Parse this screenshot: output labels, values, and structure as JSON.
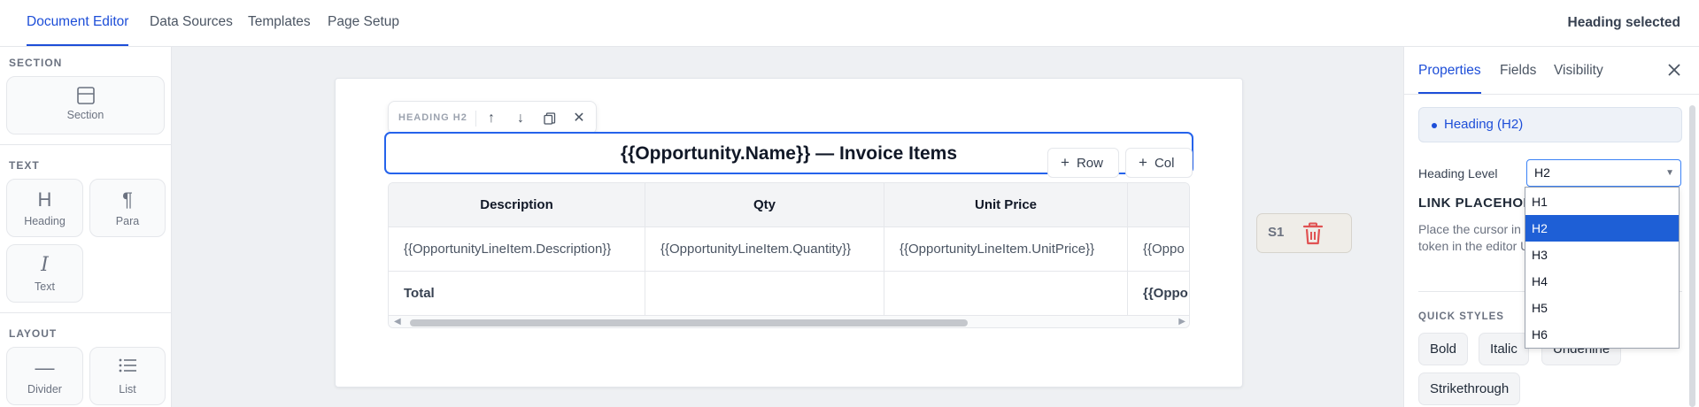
{
  "topnav": {
    "tabs": [
      "Document Editor",
      "Data Sources",
      "Templates",
      "Page Setup"
    ],
    "status": "Heading selected"
  },
  "palette": {
    "section_title": "SECTION",
    "section_item": "Section",
    "text_title": "TEXT",
    "heading_item": "Heading",
    "para_item": "Para",
    "text_item": "Text",
    "layout_title": "LAYOUT",
    "divider_item": "Divider",
    "list_item": "List"
  },
  "canvas": {
    "toolbar_label": "HEADING H2",
    "heading_text": "{{Opportunity.Name}} — Invoice Items",
    "add_row": "Row",
    "add_col": "Col",
    "table": {
      "headers": [
        "Description",
        "Qty",
        "Unit Price",
        ""
      ],
      "row1": [
        "{{OpportunityLineItem.Description}}",
        "{{OpportunityLineItem.Quantity}}",
        "{{OpportunityLineItem.UnitPrice}}",
        "{{Oppo"
      ],
      "row2": [
        "Total",
        "",
        "",
        "{{Oppo"
      ]
    },
    "section_chip": "S1"
  },
  "panel": {
    "tabs": [
      "Properties",
      "Fields",
      "Visibility"
    ],
    "selected_element": "Heading (H2)",
    "heading_level_label": "Heading Level",
    "heading_level_value": "H2",
    "heading_level_options": [
      "H1",
      "H2",
      "H3",
      "H4",
      "H5",
      "H6"
    ],
    "link_placeholder_title": "LINK PLACEHOLD",
    "link_help": "Place the cursor in token in the editor URL.",
    "quick_styles_title": "QUICK STYLES",
    "quick_styles": [
      "Bold",
      "Italic",
      "Underline",
      "Strikethrough"
    ]
  },
  "colors": {
    "accent": "#1d4ed8",
    "selection": "#2563eb",
    "delete_icon": "#e05252"
  },
  "icons": [
    "section-icon",
    "heading-icon",
    "paragraph-icon",
    "italic-text-icon",
    "divider-icon",
    "list-icon",
    "arrow-up-icon",
    "arrow-down-icon",
    "duplicate-icon",
    "close-icon",
    "plus-icon",
    "trash-icon"
  ]
}
